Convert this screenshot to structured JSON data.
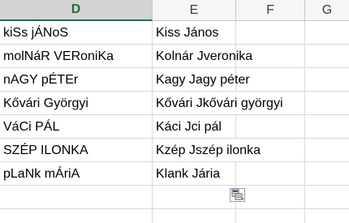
{
  "columns": [
    "D",
    "E",
    "F",
    "G"
  ],
  "rows": [
    {
      "d": "kiSs jÁNoS",
      "e": "Kiss János"
    },
    {
      "d": "molNáR VERoniKa",
      "e": "Kolnár Jveronika"
    },
    {
      "d": "nAGY pÉTEr",
      "e": "Kagy Jagy péter"
    },
    {
      "d": "Kővári Györgyi",
      "e": "Kővári Jkővári györgyi"
    },
    {
      "d": "VáCi PÁL",
      "e": "Káci Jci pál"
    },
    {
      "d": "SZÉP ILONKA",
      "e": "Kzép Jszép ilonka"
    },
    {
      "d": "pLaNk mÁriA",
      "e": "Klank Jária"
    },
    {
      "d": "",
      "e": ""
    },
    {
      "d": "",
      "e": ""
    }
  ],
  "paste_options_icon": "paste-options-icon",
  "colors": {
    "selected_header_text": "#1e6b3c",
    "selected_header_underline": "#217346",
    "gridline": "#d9d9d9"
  }
}
